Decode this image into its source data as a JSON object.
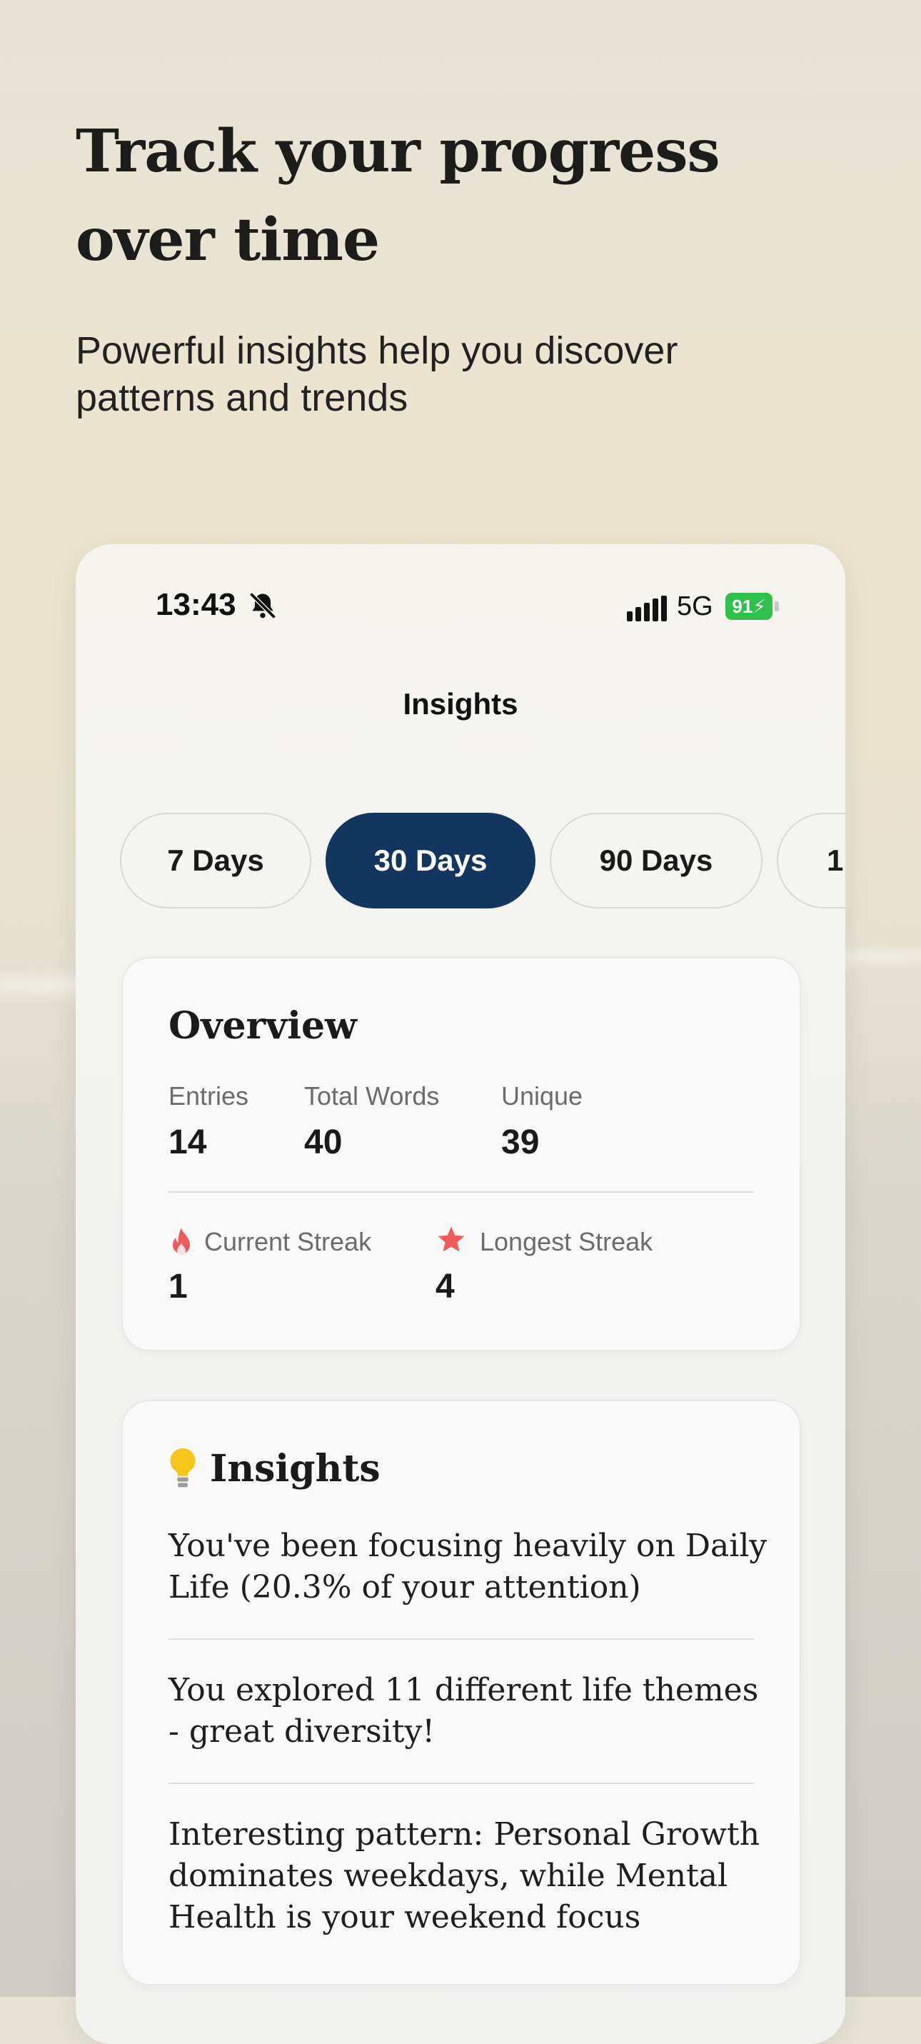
{
  "hero": {
    "title": "Track your progress over time",
    "subtitle": "Powerful insights help you discover patterns and trends"
  },
  "status_bar": {
    "time": "13:43",
    "network": "5G",
    "battery": "91"
  },
  "nav": {
    "title": "Insights"
  },
  "tabs": [
    {
      "label": "7 Days",
      "active": false
    },
    {
      "label": "30 Days",
      "active": true
    },
    {
      "label": "90 Days",
      "active": false
    },
    {
      "label": "1",
      "active": false
    }
  ],
  "overview": {
    "title": "Overview",
    "stats": [
      {
        "label": "Entries",
        "value": "14"
      },
      {
        "label": "Total Words",
        "value": "40"
      },
      {
        "label": "Unique",
        "value": "39"
      }
    ],
    "streaks": [
      {
        "label": "Current Streak",
        "value": "1",
        "icon": "flame-icon"
      },
      {
        "label": "Longest Streak",
        "value": "4",
        "icon": "star-icon"
      }
    ]
  },
  "insights": {
    "title": "Insights",
    "icon": "lightbulb-icon",
    "items": [
      "You've been focusing heavily on Daily Life (20.3% of your attention)",
      "You explored 11 different life themes - great diversity!",
      "Interesting pattern: Personal Growth dominates weekdays, while Mental Health is your weekend focus"
    ]
  },
  "colors": {
    "accent": "#123660",
    "battery": "#2fc24a",
    "flame": "#f05a5a",
    "star": "#f05a5a",
    "bulb": "#f5c518"
  }
}
